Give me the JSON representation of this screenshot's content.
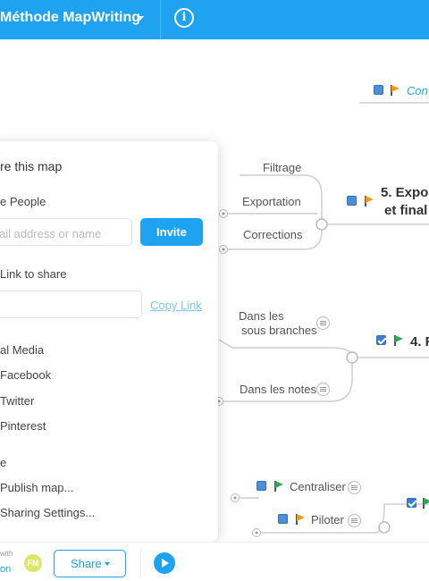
{
  "header": {
    "title": "Méthode MapWriting",
    "info_icon": "i"
  },
  "map": {
    "n_conclusion": "Con",
    "n_filtrage": "Filtrage",
    "n_exportation": "Exportation",
    "n_corrections": "Corrections",
    "n_export_line1": "5. Expo",
    "n_export_line2": "et final",
    "n_dans_les": "Dans les",
    "n_sous_branches": "sous branches",
    "n_4": "4. F",
    "n_dans_notes": "Dans les notes",
    "n_centraliser": "Centraliser",
    "n_piloter": "Piloter"
  },
  "share_panel": {
    "title": "re this map",
    "people_label": "e People",
    "email_placeholder": "ail address or name",
    "invite": "Invite",
    "link_label": "Link to share",
    "copy_link": "Copy Link",
    "social_label": "al Media",
    "facebook": "Facebook",
    "twitter": "Twitter",
    "pinterest": "Pinterest",
    "more_label": "e",
    "publish": "Publish map...",
    "sharing_settings": "Sharing Settings..."
  },
  "footer": {
    "with": "with",
    "on": "on",
    "avatar": "FM",
    "share": "Share"
  },
  "colors": {
    "accent": "#1fa3f0",
    "flag_orange": "#f39c12",
    "flag_green": "#2fa84f",
    "checkbox": "#4a8fd8"
  }
}
